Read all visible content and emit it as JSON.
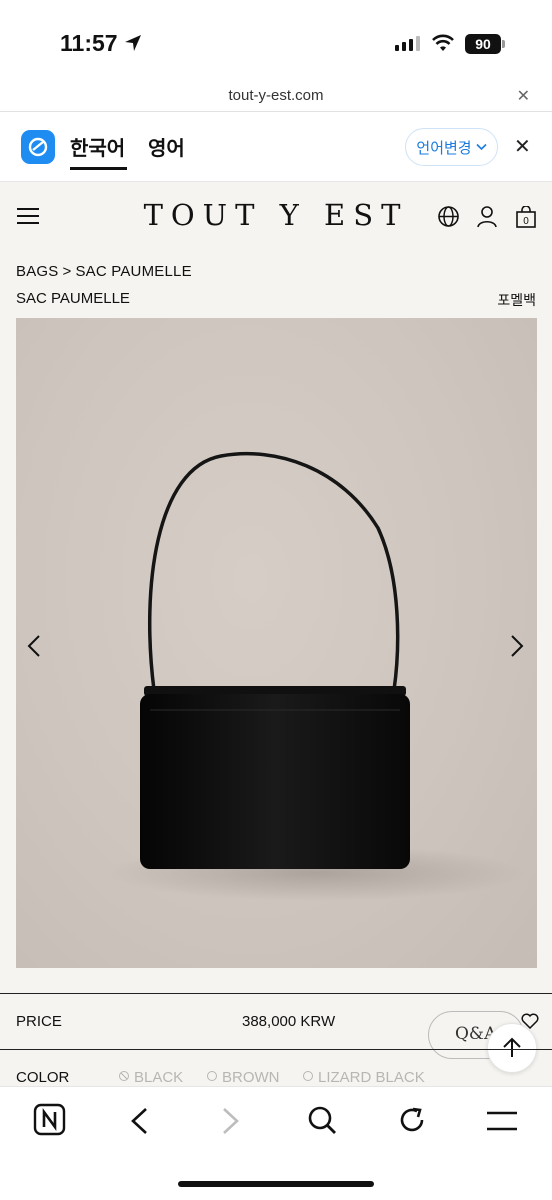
{
  "status": {
    "time": "11:57",
    "battery": "90"
  },
  "browser": {
    "url": "tout-y-est.com"
  },
  "translate": {
    "active_lang": "한국어",
    "other_lang": "영어",
    "change_button": "언어변경"
  },
  "site": {
    "brand": "TOUT Y EST",
    "cart_count": "0"
  },
  "breadcrumb": {
    "category": "BAGS",
    "separator": ">",
    "current": "SAC PAUMELLE"
  },
  "product": {
    "name": "SAC PAUMELLE",
    "name_korean": "포멜백",
    "price_label": "PRICE",
    "price": "388,000 KRW",
    "qa_button": "Q&A",
    "color_label": "COLOR",
    "colors": [
      "BLACK",
      "BROWN",
      "LIZARD BLACK"
    ]
  },
  "colors": {
    "accent_blue": "#1e8cf0",
    "photo_bg": "#cec6be",
    "bag": "#0d0d0d",
    "inactive_text": "#b8b6b3"
  }
}
